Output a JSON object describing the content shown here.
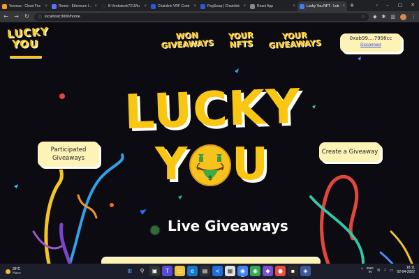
{
  "browser": {
    "tabs": [
      {
        "title": "Vevmus - Cloud Firs",
        "favicon": "cloud-icon",
        "color": "#f4a12b",
        "active": false
      },
      {
        "title": "Remix - Ethereum IDE",
        "favicon": "remix-icon",
        "color": "#5f6fff",
        "active": false
      },
      {
        "title": "B-Venkatesh7210/lu",
        "favicon": "github-icon",
        "color": "#24292e",
        "active": false
      },
      {
        "title": "Chainlink VRF Contr",
        "favicon": "chainlink-icon",
        "color": "#2a5ada",
        "active": false
      },
      {
        "title": "PegSwap | Chainlink",
        "favicon": "chainlink-icon",
        "color": "#2a5ada",
        "active": false
      },
      {
        "title": "React App",
        "favicon": "globe-icon",
        "color": "#888888",
        "active": false
      },
      {
        "title": "Lucky You NFT - Lotr",
        "favicon": "globe-icon",
        "color": "#3c80f6",
        "active": true
      }
    ],
    "new_tab": "+",
    "url": "localhost:3000/home",
    "window_controls": [
      "–",
      "▢",
      "✕"
    ]
  },
  "header": {
    "logo_line1": "LUCKY",
    "logo_line2": "YOU",
    "nav": [
      {
        "label": "WON GIVEAWAYS"
      },
      {
        "label": "YOUR NFTS"
      },
      {
        "label": "YOUR GIVEAWAYS"
      }
    ],
    "wallet_address": "0xab99....7998cc",
    "disconnect_label": "Disconnect"
  },
  "hero": {
    "title_line1": "LUCKY",
    "title_y": "Y",
    "title_u": "U",
    "emoji": "money-mouth-face-icon"
  },
  "buttons": {
    "participated": "Participated Giveaways",
    "create": "Create a Giveaway"
  },
  "section": {
    "live_title": "Live Giveaways"
  },
  "taskbar": {
    "weather_temp": "36°C",
    "weather_desc": "Haze",
    "lang_top": "ENG",
    "lang_bottom": "IN",
    "time": "18:11",
    "date": "02-04-2022"
  },
  "colors": {
    "brand_yellow": "#f9c611",
    "card_cream": "#fdf3b6",
    "background": "#0c0b12",
    "link_blue": "#2d3df2"
  }
}
